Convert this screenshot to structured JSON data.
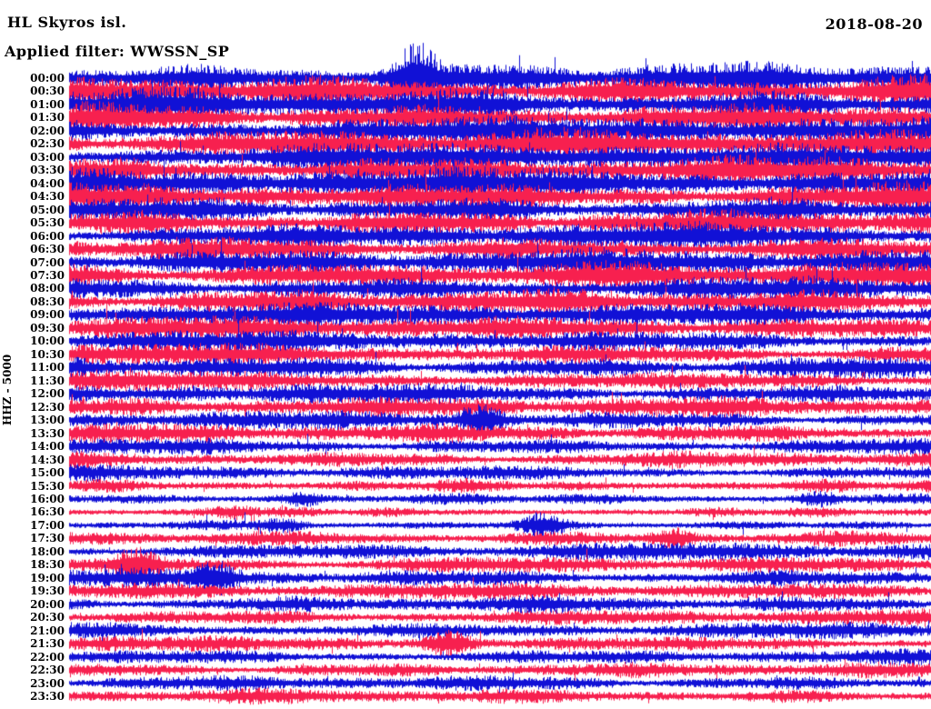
{
  "header": {
    "station_title": "HL Skyros isl.",
    "date": "2018-08-20",
    "filter_label": "Applied filter: WWSSN_SP"
  },
  "left_axis": {
    "scale_label": "HHZ - 5000"
  },
  "colors": {
    "background": "#ffffff",
    "text": "#000000",
    "trace_blue": "#1111d6",
    "trace_red": "#f7204f"
  },
  "chart_data": {
    "type": "helicorder",
    "title": "HL Skyros isl.",
    "date": "2018-08-20",
    "filter": "WWSSN_SP",
    "channel": "HHZ",
    "gain_scale": 5000,
    "minutes_per_row": 30,
    "rows_total": 48,
    "row_color_alternation": [
      "blue",
      "red"
    ],
    "x_axis": "each row spans 30 minutes of continuous waveform, left edge = labeled time",
    "y_axis": "time of day (UTC), 00:00 at top to 23:30 at bottom",
    "legend_position": "none",
    "grid": false,
    "rows": [
      {
        "time": "00:00",
        "color": "blue",
        "amp": 19,
        "bursts": [
          0.4
        ]
      },
      {
        "time": "00:30",
        "color": "red",
        "amp": 19,
        "bursts": []
      },
      {
        "time": "01:00",
        "color": "blue",
        "amp": 19,
        "bursts": []
      },
      {
        "time": "01:30",
        "color": "red",
        "amp": 18,
        "bursts": []
      },
      {
        "time": "02:00",
        "color": "blue",
        "amp": 19,
        "bursts": []
      },
      {
        "time": "02:30",
        "color": "red",
        "amp": 18,
        "bursts": []
      },
      {
        "time": "03:00",
        "color": "blue",
        "amp": 18,
        "bursts": []
      },
      {
        "time": "03:30",
        "color": "red",
        "amp": 18,
        "bursts": []
      },
      {
        "time": "04:00",
        "color": "blue",
        "amp": 19,
        "bursts": []
      },
      {
        "time": "04:30",
        "color": "red",
        "amp": 18,
        "bursts": []
      },
      {
        "time": "05:00",
        "color": "blue",
        "amp": 17,
        "bursts": []
      },
      {
        "time": "05:30",
        "color": "red",
        "amp": 17,
        "bursts": []
      },
      {
        "time": "06:00",
        "color": "blue",
        "amp": 16,
        "bursts": []
      },
      {
        "time": "06:30",
        "color": "red",
        "amp": 16,
        "bursts": []
      },
      {
        "time": "07:00",
        "color": "blue",
        "amp": 16,
        "bursts": []
      },
      {
        "time": "07:30",
        "color": "red",
        "amp": 16,
        "bursts": []
      },
      {
        "time": "08:00",
        "color": "blue",
        "amp": 15,
        "bursts": []
      },
      {
        "time": "08:30",
        "color": "red",
        "amp": 15,
        "bursts": []
      },
      {
        "time": "09:00",
        "color": "blue",
        "amp": 14,
        "bursts": []
      },
      {
        "time": "09:30",
        "color": "red",
        "amp": 14,
        "bursts": []
      },
      {
        "time": "10:00",
        "color": "blue",
        "amp": 13,
        "bursts": []
      },
      {
        "time": "10:30",
        "color": "red",
        "amp": 13,
        "bursts": []
      },
      {
        "time": "11:00",
        "color": "blue",
        "amp": 13,
        "bursts": []
      },
      {
        "time": "11:30",
        "color": "red",
        "amp": 12,
        "bursts": []
      },
      {
        "time": "12:00",
        "color": "blue",
        "amp": 12,
        "bursts": []
      },
      {
        "time": "12:30",
        "color": "red",
        "amp": 12,
        "bursts": []
      },
      {
        "time": "13:00",
        "color": "blue",
        "amp": 11,
        "bursts": [
          0.48
        ]
      },
      {
        "time": "13:30",
        "color": "red",
        "amp": 11,
        "bursts": []
      },
      {
        "time": "14:00",
        "color": "blue",
        "amp": 10,
        "bursts": []
      },
      {
        "time": "14:30",
        "color": "red",
        "amp": 10,
        "bursts": []
      },
      {
        "time": "15:00",
        "color": "blue",
        "amp": 9,
        "bursts": []
      },
      {
        "time": "15:30",
        "color": "red",
        "amp": 8,
        "bursts": []
      },
      {
        "time": "16:00",
        "color": "blue",
        "amp": 7,
        "bursts": [
          0.27,
          0.87
        ]
      },
      {
        "time": "16:30",
        "color": "red",
        "amp": 6,
        "bursts": [
          0.19
        ]
      },
      {
        "time": "17:00",
        "color": "blue",
        "amp": 6,
        "bursts": [
          0.25,
          0.55
        ]
      },
      {
        "time": "17:30",
        "color": "red",
        "amp": 10,
        "bursts": [
          0.7
        ]
      },
      {
        "time": "18:00",
        "color": "blue",
        "amp": 11,
        "bursts": []
      },
      {
        "time": "18:30",
        "color": "red",
        "amp": 10,
        "bursts": [
          0.08
        ]
      },
      {
        "time": "19:00",
        "color": "blue",
        "amp": 11,
        "bursts": [
          0.17
        ]
      },
      {
        "time": "19:30",
        "color": "red",
        "amp": 10,
        "bursts": []
      },
      {
        "time": "20:00",
        "color": "blue",
        "amp": 10,
        "bursts": []
      },
      {
        "time": "20:30",
        "color": "red",
        "amp": 10,
        "bursts": []
      },
      {
        "time": "21:00",
        "color": "blue",
        "amp": 10,
        "bursts": []
      },
      {
        "time": "21:30",
        "color": "red",
        "amp": 9,
        "bursts": [
          0.44
        ]
      },
      {
        "time": "22:00",
        "color": "blue",
        "amp": 9,
        "bursts": []
      },
      {
        "time": "22:30",
        "color": "red",
        "amp": 9,
        "bursts": []
      },
      {
        "time": "23:00",
        "color": "blue",
        "amp": 9,
        "bursts": []
      },
      {
        "time": "23:30",
        "color": "red",
        "amp": 9,
        "bursts": []
      }
    ]
  }
}
